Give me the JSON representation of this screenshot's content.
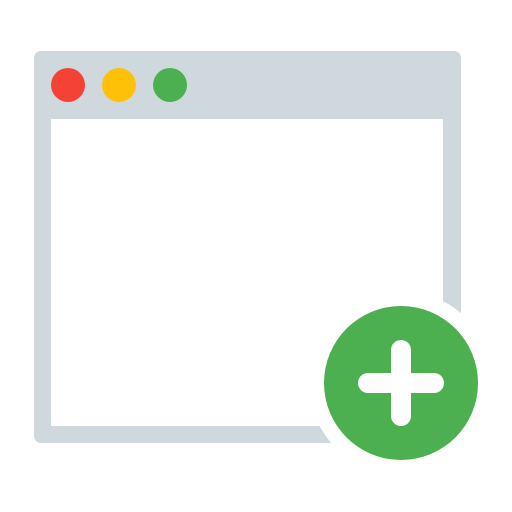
{
  "icon": {
    "name": "new-window-icon",
    "colors": {
      "window_frame": "#CFD8DC",
      "window_content": "#FFFFFF",
      "close_dot": "#F44336",
      "minimize_dot": "#FFC107",
      "maximize_dot": "#4CAF50",
      "add_badge": "#4CAF50",
      "plus_sign": "#FFFFFF",
      "background": "#FFFFFF"
    }
  }
}
